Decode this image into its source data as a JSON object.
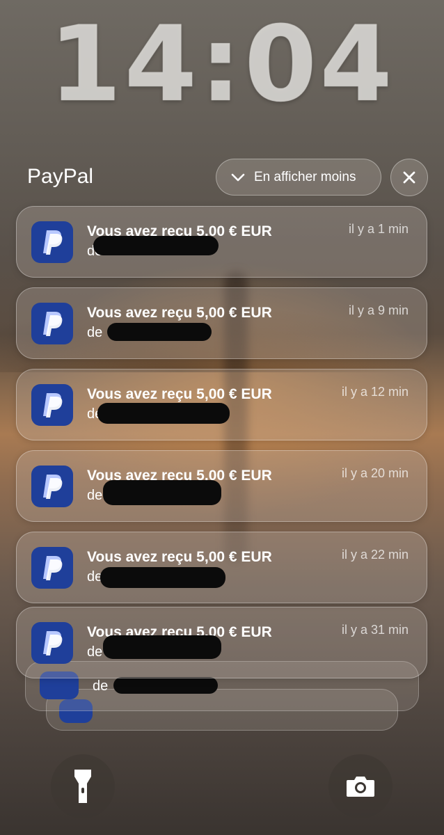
{
  "lockscreen": {
    "time": "14:04"
  },
  "group": {
    "app_name": "PayPal",
    "collapse_label": "En afficher moins",
    "icons": {
      "collapse": "chevron-down-icon",
      "close": "close-icon",
      "app": "paypal-icon"
    }
  },
  "notifications": [
    {
      "title": "Vous avez reçu 5,00 € EUR",
      "sender": "de",
      "time": "il y a 1 min"
    },
    {
      "title": "Vous avez reçu 5,00 € EUR",
      "sender": "de",
      "time": "il y a 9 min"
    },
    {
      "title": "Vous avez reçu 5,00 € EUR",
      "sender": "de",
      "time": "il y a 12 min"
    },
    {
      "title": "Vous avez reçu 5,00 € EUR",
      "sender": "de",
      "time": "il y a 20 min"
    },
    {
      "title": "Vous avez reçu 5,00 € EUR",
      "sender": "de",
      "time": "il y a 22 min"
    },
    {
      "title": "Vous avez reçu 5,00 € EUR",
      "sender": "de",
      "time": "il y a 31 min"
    }
  ],
  "stacked": [
    {
      "sender": "de"
    }
  ],
  "quick_actions": {
    "left": "flashlight-icon",
    "right": "camera-icon"
  },
  "colors": {
    "paypal_blue": "#1f3f9a",
    "paypal_light": "#b8c8ff"
  }
}
